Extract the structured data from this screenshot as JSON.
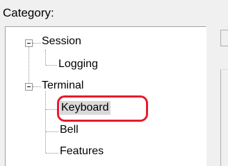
{
  "category_label": "Category:",
  "tree": {
    "items": [
      {
        "label": "Session",
        "expanded": true
      },
      {
        "label": "Logging"
      },
      {
        "label": "Terminal",
        "expanded": true
      },
      {
        "label": "Keyboard",
        "selected": true
      },
      {
        "label": "Bell"
      },
      {
        "label": "Features"
      }
    ]
  },
  "annotation_color": "#e8192c"
}
